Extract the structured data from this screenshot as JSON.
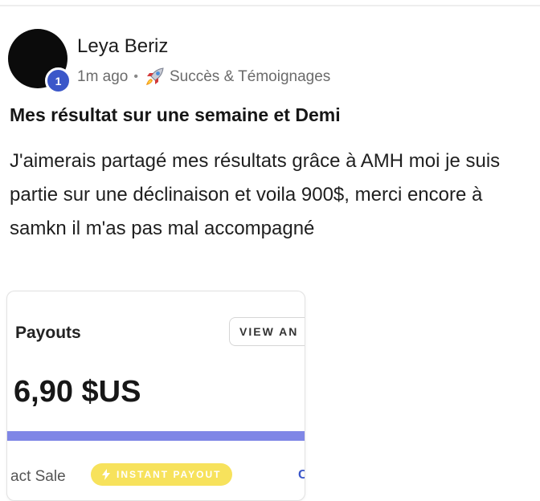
{
  "post": {
    "author_name": "Leya Beriz",
    "level": "1",
    "timestamp": "1m ago",
    "separator": "•",
    "category_icon": "rocket-icon",
    "category": "Succès & Témoignages",
    "title": "Mes résultat sur une semaine et Demi",
    "body": "J'aimerais partagé mes résultats grâce à AMH moi je suis partie sur une déclinaison et voila 900$, merci encore à samkn il m'as pas mal accompagné"
  },
  "card": {
    "title": "Payouts",
    "view_button": "VIEW AN",
    "amount": "6,90 $US",
    "progress_fraction": 1.0,
    "sale_label": "act Sale",
    "badge_icon": "bolt-icon",
    "badge_label": "INSTANT PAYOUT",
    "edge_char": "C"
  },
  "colors": {
    "level_badge": "#3b57c9",
    "progress_fill": "#7f86e6",
    "instant_badge": "#f7e25c"
  }
}
